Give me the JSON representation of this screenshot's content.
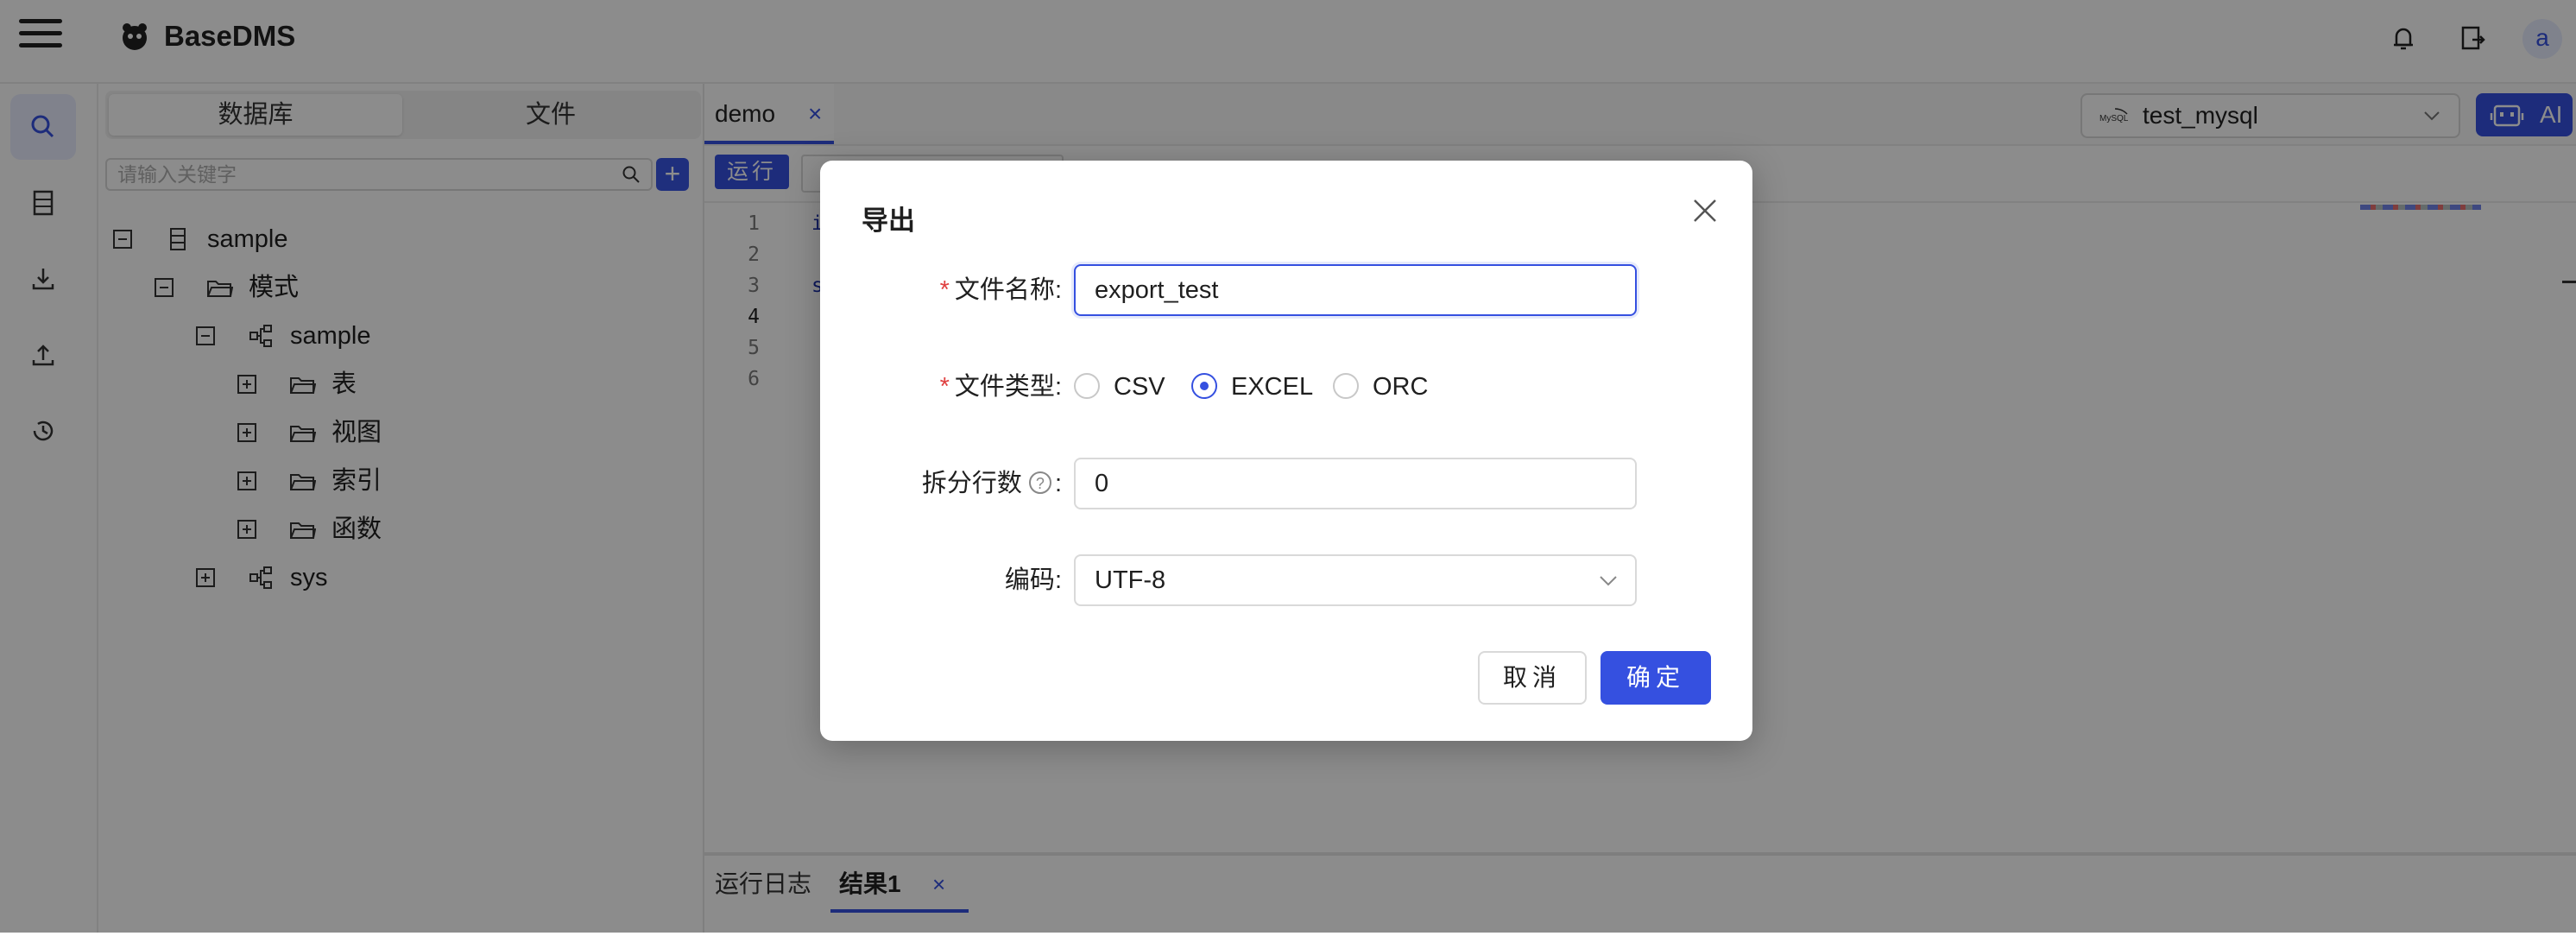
{
  "header": {
    "title": "BaseDMS",
    "avatar_letter": "a"
  },
  "sidebar": {
    "tabs": [
      {
        "label": "数据库"
      },
      {
        "label": "文件"
      }
    ],
    "search": {
      "placeholder": "请输入关键字",
      "value": ""
    },
    "add_label": "+",
    "tree": [
      {
        "label": "sample",
        "icon": "database-icon",
        "toggle": "minus"
      },
      {
        "label": "模式",
        "icon": "folder-icon",
        "toggle": "minus"
      },
      {
        "label": "sample",
        "icon": "schema-icon",
        "toggle": "minus"
      },
      {
        "label": "表",
        "icon": "folder-icon",
        "toggle": "plus"
      },
      {
        "label": "视图",
        "icon": "folder-icon",
        "toggle": "plus"
      },
      {
        "label": "索引",
        "icon": "folder-icon",
        "toggle": "plus"
      },
      {
        "label": "函数",
        "icon": "folder-icon",
        "toggle": "plus"
      },
      {
        "label": "sys",
        "icon": "schema-icon",
        "toggle": "plus"
      }
    ]
  },
  "editor": {
    "tab": {
      "label": "demo",
      "close": "×"
    },
    "connection": {
      "value": "test_mysql"
    },
    "ai_label": "AI",
    "run_label": "运行",
    "line_numbers": [
      "1",
      "2",
      "3",
      "4",
      "5",
      "6"
    ],
    "code_fragments": [
      "i",
      "s"
    ],
    "bottom_tabs": [
      {
        "label": "运行日志"
      },
      {
        "label": "结果1"
      }
    ],
    "bottom_close": "×"
  },
  "modal": {
    "title": "导出",
    "fields": {
      "filename": {
        "label": "文件名称",
        "required": "*",
        "value": "export_test"
      },
      "filetype": {
        "label": "文件类型",
        "required": "*",
        "options": [
          "CSV",
          "EXCEL",
          "ORC"
        ],
        "selected": "EXCEL"
      },
      "split_rows": {
        "label": "拆分行数",
        "help": "?",
        "value": "0"
      },
      "encoding": {
        "label": "编码",
        "value": "UTF-8"
      }
    },
    "colon": ":",
    "cancel_label": "取消",
    "ok_label": "确定"
  },
  "colors": {
    "primary": "#3550e0",
    "required": "#e04040"
  }
}
